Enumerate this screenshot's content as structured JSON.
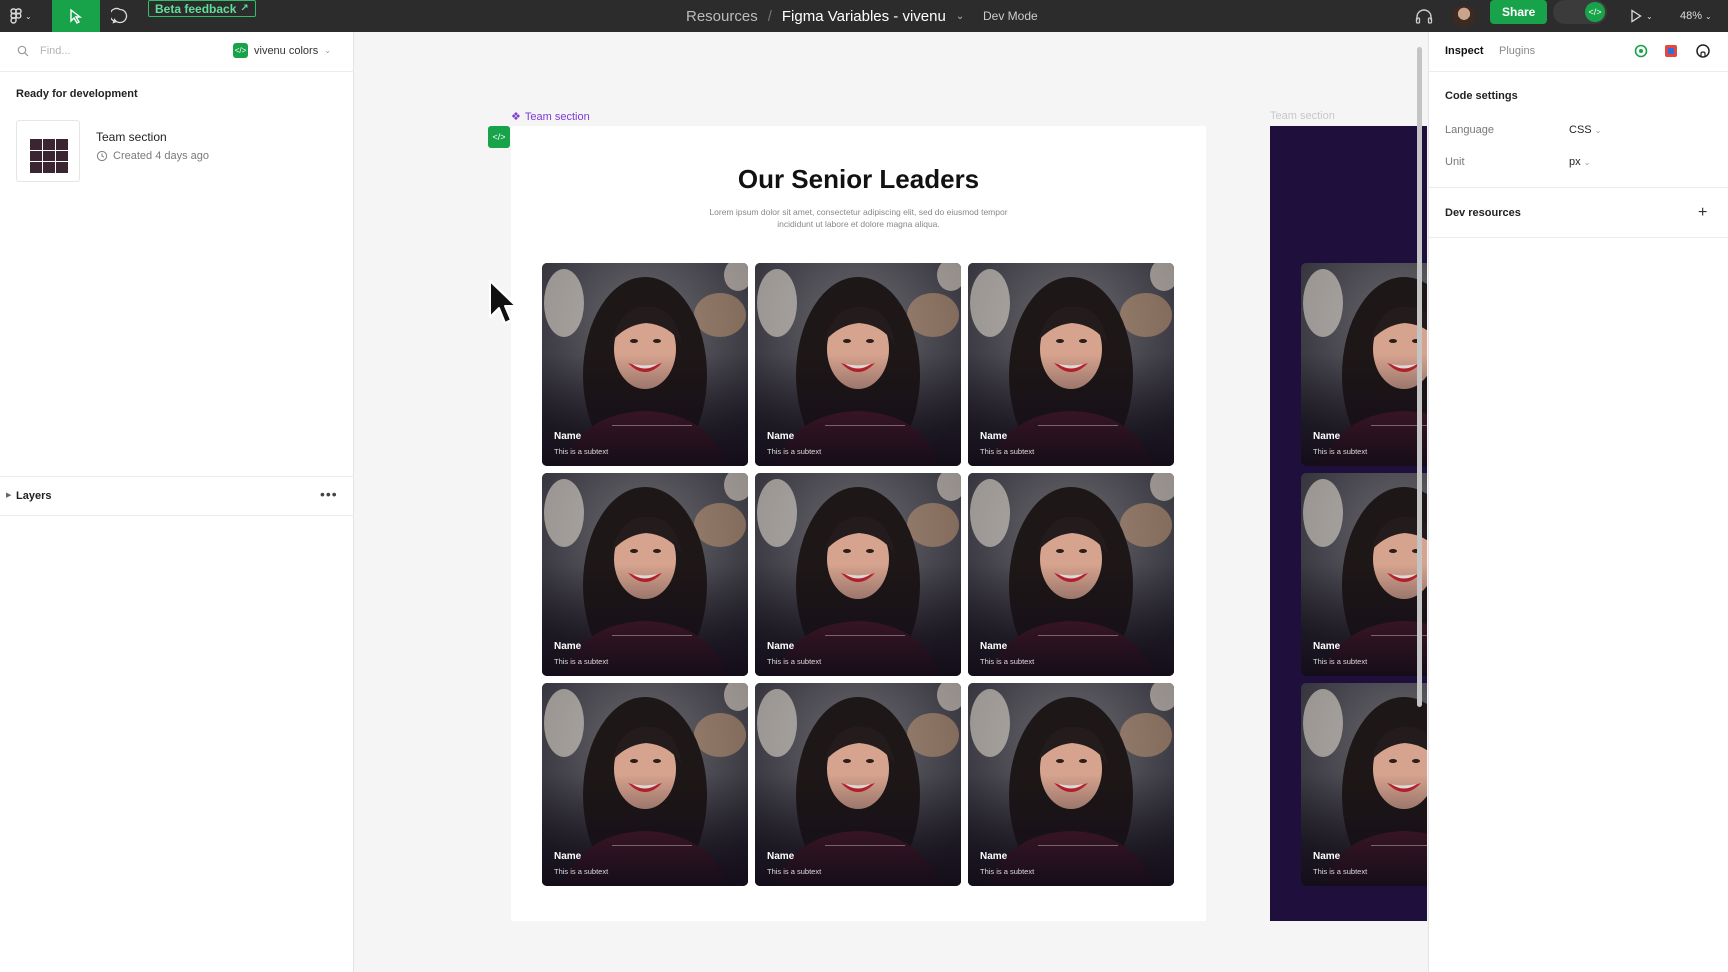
{
  "topbar": {
    "beta_label": "Beta feedback",
    "breadcrumb_project": "Resources",
    "breadcrumb_file": "Figma Variables - vivenu",
    "dev_mode_label": "Dev Mode",
    "share_label": "Share",
    "zoom_label": "48%"
  },
  "left_panel": {
    "search_placeholder": "Find...",
    "library_label": "vivenu colors",
    "ready_heading": "Ready for development",
    "item_title": "Team section",
    "item_meta": "Created 4 days ago",
    "layers_label": "Layers"
  },
  "canvas": {
    "frame_label": "Team section",
    "frame_label_secondary": "Team section",
    "title": "Our Senior Leaders",
    "subtitle": "Lorem ipsum dolor sit amet, consectetur adipiscing elit, sed do eiusmod tempor incididunt ut labore et dolore magna aliqua.",
    "card_name": "Name",
    "card_subtext": "This is a subtext",
    "frame2_bg": "#1f0f3d"
  },
  "right_panel": {
    "tab_inspect": "Inspect",
    "tab_plugins": "Plugins",
    "code_settings_heading": "Code settings",
    "language_label": "Language",
    "language_value": "CSS",
    "unit_label": "Unit",
    "unit_value": "px",
    "dev_resources_heading": "Dev resources"
  },
  "colors": {
    "accent_green": "#18a34a",
    "topbar_bg": "#2c2c2c",
    "component_purple": "#7d3bd6"
  }
}
